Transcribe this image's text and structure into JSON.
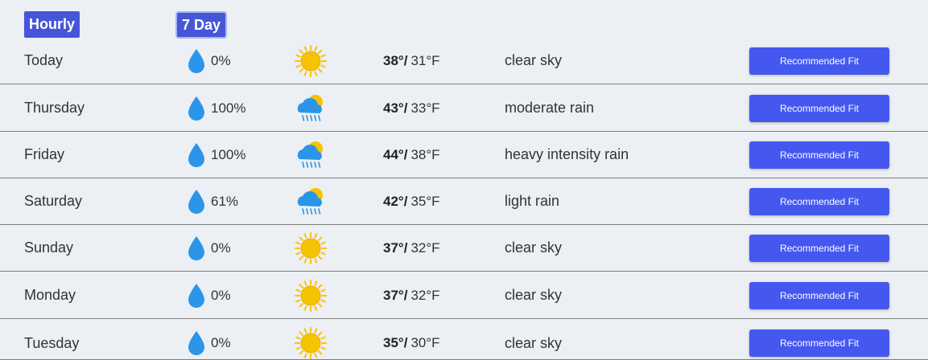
{
  "tabs": {
    "hourly": "Hourly",
    "seven_day": "7 Day"
  },
  "icons": {
    "drop_color": "#2b95ea",
    "sun_color": "#f7c300",
    "rain_cloud_color": "#2b95ea"
  },
  "button_color": "#4458f0",
  "days": [
    {
      "day": "Today",
      "precip": "0%",
      "icon": "sun-icon",
      "hi": "38°/",
      "lo": "31°F",
      "desc": "clear sky",
      "button": "Recommended Fit"
    },
    {
      "day": "Thursday",
      "precip": "100%",
      "icon": "rain-cloud-icon",
      "hi": "43°/",
      "lo": "33°F",
      "desc": "moderate rain",
      "button": "Recommended Fit"
    },
    {
      "day": "Friday",
      "precip": "100%",
      "icon": "rain-cloud-icon",
      "hi": "44°/",
      "lo": "38°F",
      "desc": "heavy intensity rain",
      "button": "Recommended Fit"
    },
    {
      "day": "Saturday",
      "precip": "61%",
      "icon": "rain-cloud-icon",
      "hi": "42°/",
      "lo": "35°F",
      "desc": "light rain",
      "button": "Recommended Fit"
    },
    {
      "day": "Sunday",
      "precip": "0%",
      "icon": "sun-icon",
      "hi": "37°/",
      "lo": "32°F",
      "desc": "clear sky",
      "button": "Recommended Fit"
    },
    {
      "day": "Monday",
      "precip": "0%",
      "icon": "sun-icon",
      "hi": "37°/",
      "lo": "32°F",
      "desc": "clear sky",
      "button": "Recommended Fit"
    },
    {
      "day": "Tuesday",
      "precip": "0%",
      "icon": "sun-icon",
      "hi": "35°/",
      "lo": "30°F",
      "desc": "clear sky",
      "button": "Recommended Fit"
    }
  ]
}
